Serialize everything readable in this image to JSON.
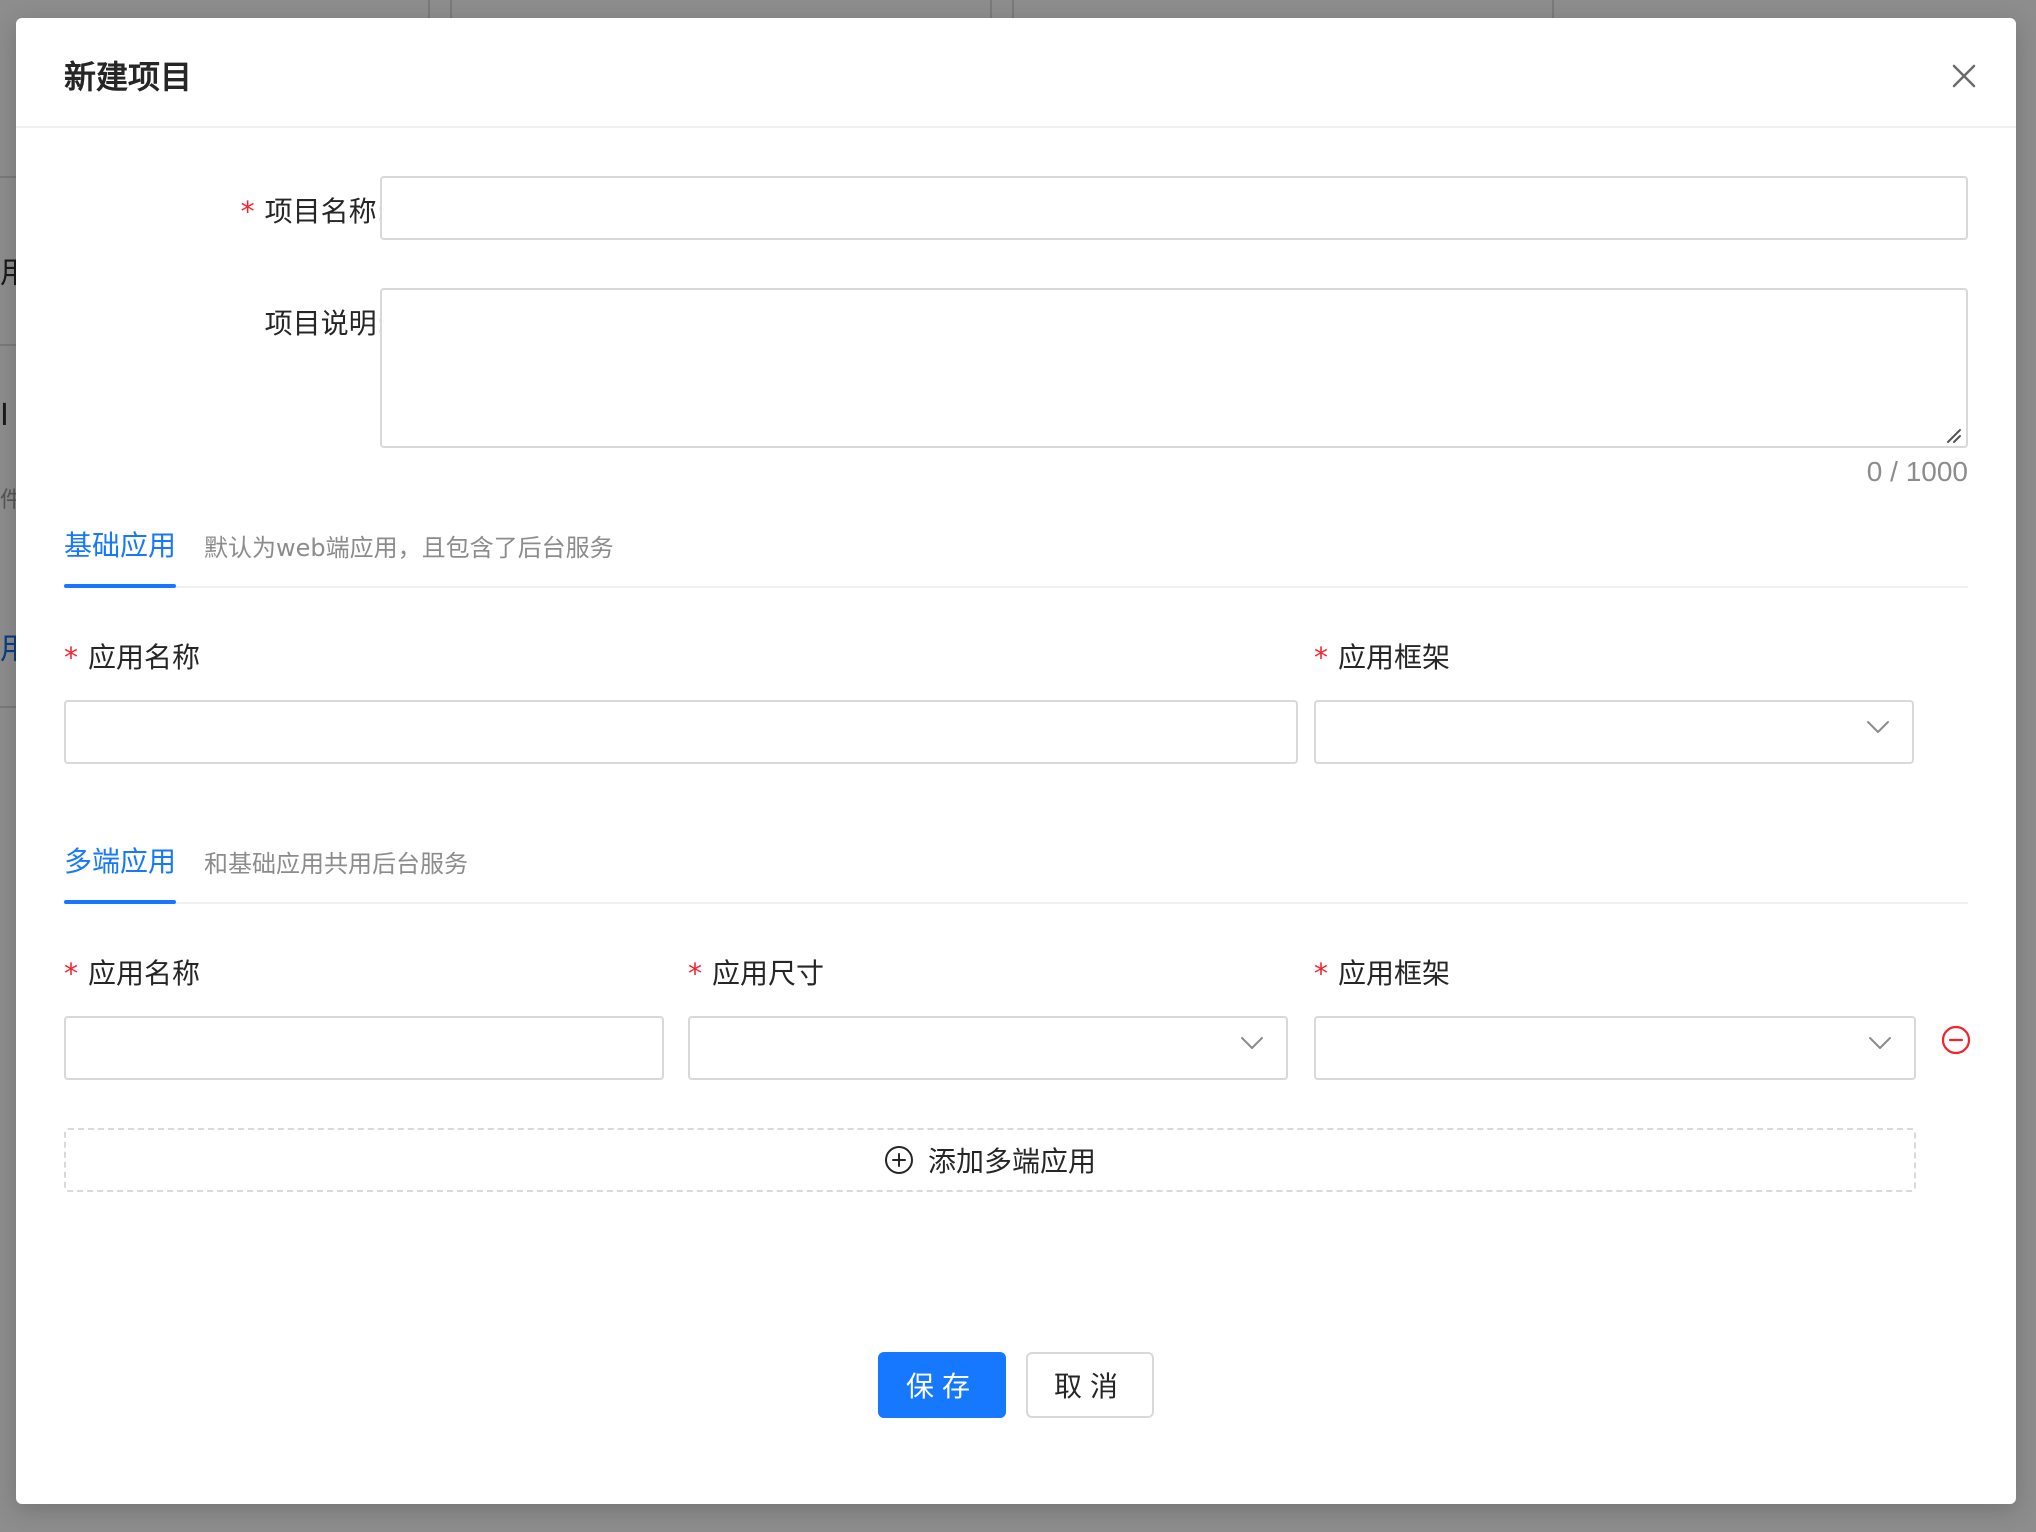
{
  "background": {
    "fragments": [
      "用",
      "I",
      "件",
      "用"
    ]
  },
  "modal": {
    "title": "新建项目",
    "close_icon": "close-icon"
  },
  "form": {
    "project_name": {
      "label": "项目名称:",
      "value": "",
      "required": true
    },
    "project_desc": {
      "label": "项目说明:",
      "value": "",
      "counter": "0 / 1000"
    }
  },
  "basic_app": {
    "tab_label": "基础应用",
    "description": "默认为web端应用，且包含了后台服务",
    "app_name_label": "应用名称",
    "framework_label": "应用框架",
    "app_name_value": "",
    "framework_value": ""
  },
  "multi_app": {
    "tab_label": "多端应用",
    "description": "和基础应用共用后台服务",
    "app_name_label": "应用名称",
    "size_label": "应用尺寸",
    "framework_label": "应用框架",
    "app_name_value": "",
    "size_value": "",
    "framework_value": "",
    "add_button_label": "添加多端应用"
  },
  "footer": {
    "save_label": "保存",
    "cancel_label": "取消"
  },
  "colors": {
    "primary": "#1677ff",
    "required": "#f5222d",
    "remove": "#f5222d"
  }
}
